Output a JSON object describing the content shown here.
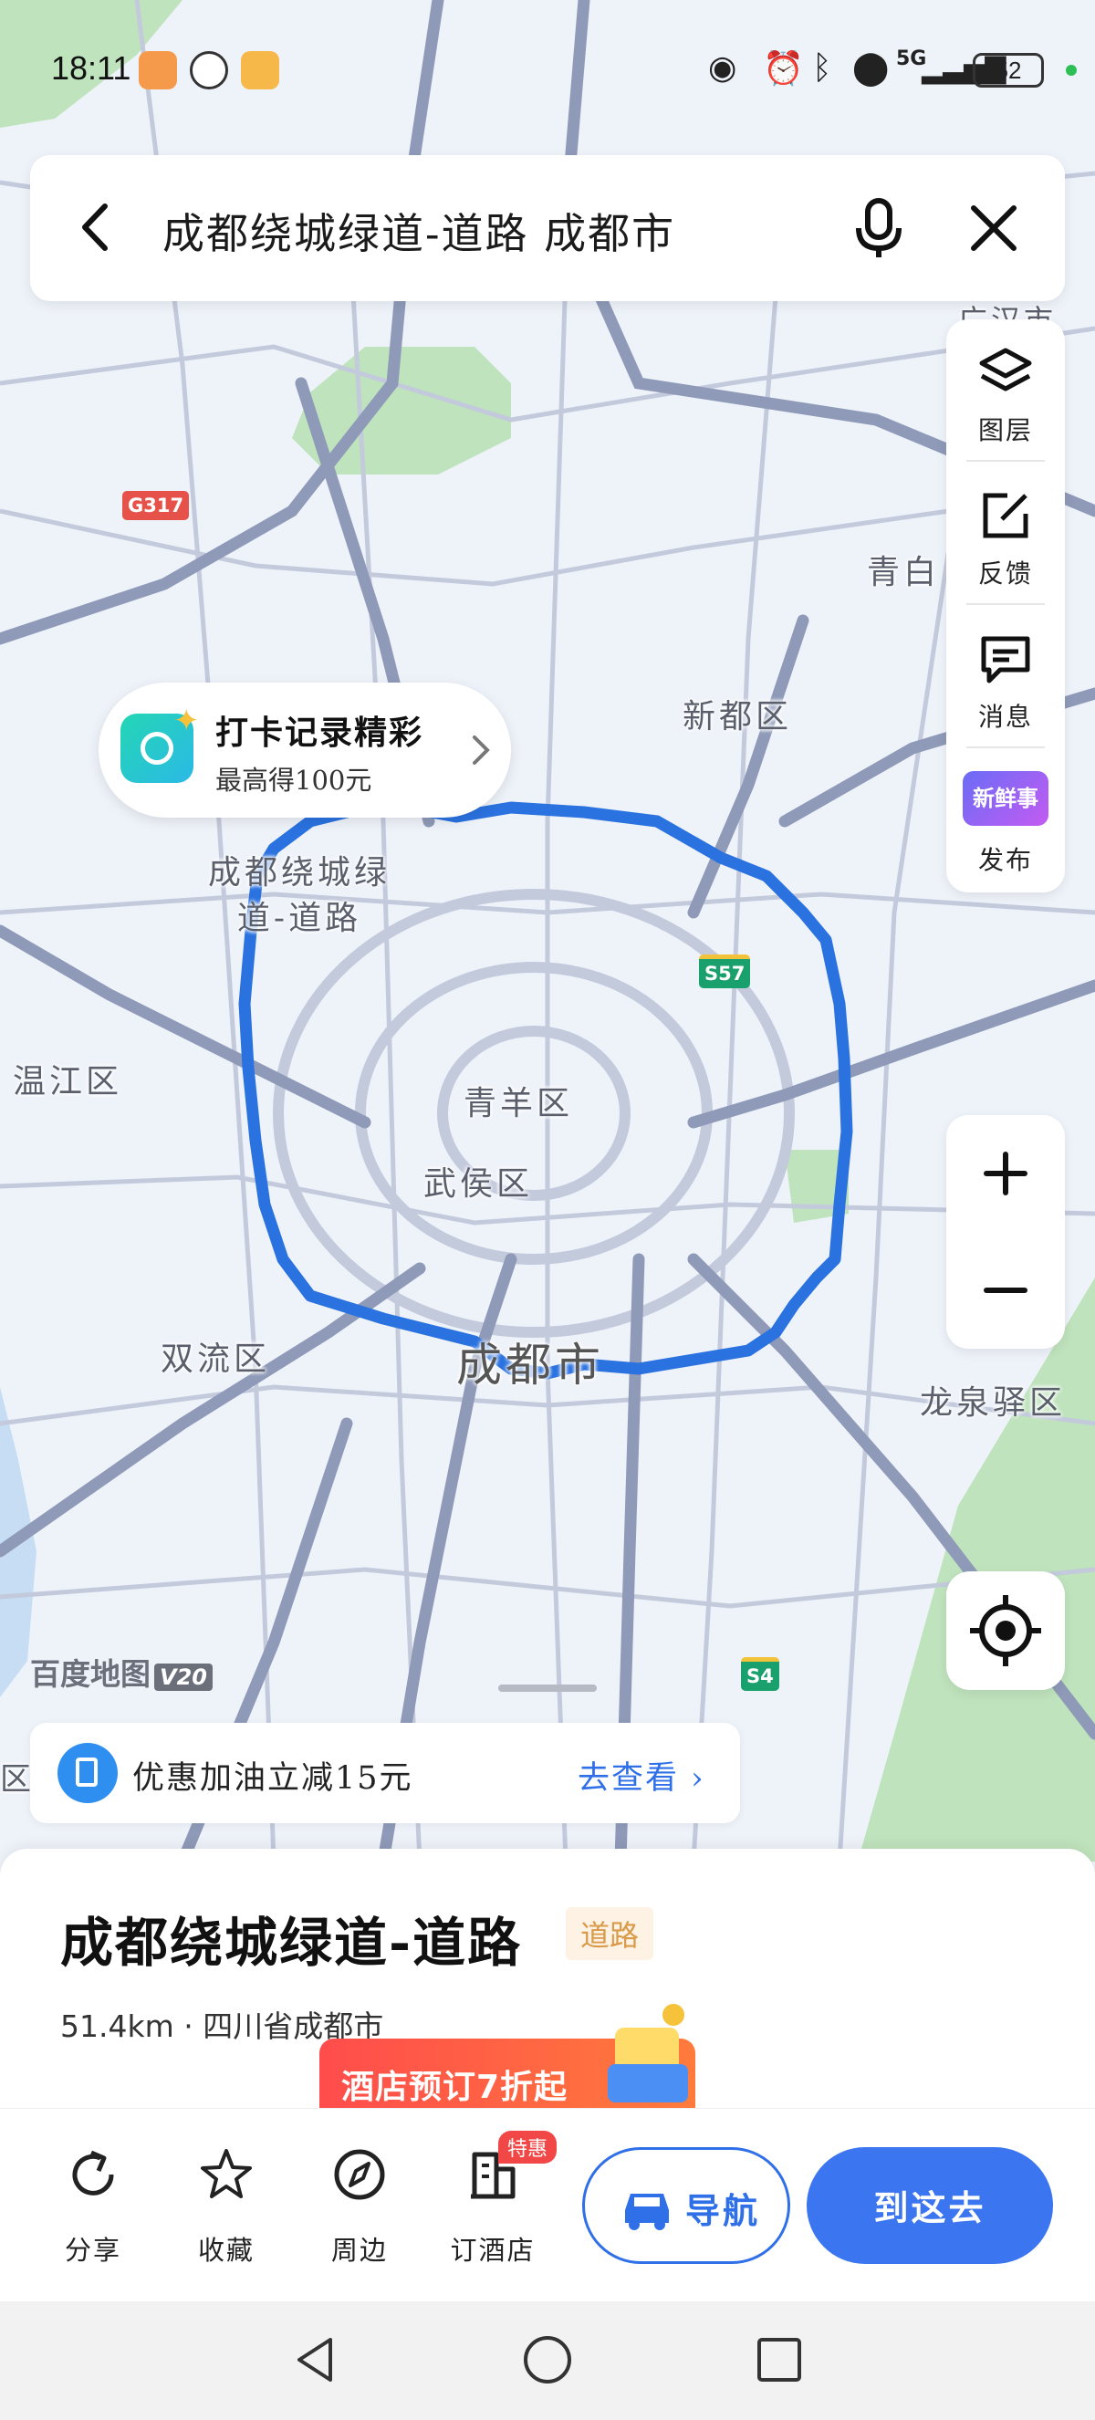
{
  "status_bar": {
    "time": "18:11",
    "network": "5G",
    "battery": "52"
  },
  "search": {
    "query": "成都绕城绿道-道路  成都市"
  },
  "map_tools": [
    {
      "label": "图层",
      "icon": "layers-icon"
    },
    {
      "label": "反馈",
      "icon": "feedback-icon"
    },
    {
      "label": "消息",
      "icon": "message-icon"
    },
    {
      "label": "发布",
      "icon": "new-thing-icon",
      "badge": "新鲜事"
    }
  ],
  "checkin": {
    "title": "打卡记录精彩",
    "subtitle": "最高得100元"
  },
  "map": {
    "labels": {
      "route": "成都绕城绿\n道-道路",
      "xindu": "新都区",
      "qingbai": "青白",
      "guanghan": "广汉市",
      "wenjiang": "温江区",
      "qingyang": "青羊区",
      "wuhou": "武侯区",
      "shuangliu": "双流区",
      "chengdu": "成都市",
      "longquanyi": "龙泉驿区",
      "qu_edge": "区"
    },
    "shields": {
      "g317": "G317",
      "s57": "S57",
      "s4": "S4"
    },
    "logo": "百度地图",
    "logo_version": "V20",
    "colors": {
      "route": "#2a72e0",
      "road_major": "#8e9ab8",
      "road_minor": "#c3cadc",
      "green": "#bfe3bd",
      "water": "#9fc7f0"
    }
  },
  "fuel_banner": {
    "text": "优惠加油立减15元",
    "link": "去查看"
  },
  "place": {
    "title": "成都绕城绿道-道路",
    "tag": "道路",
    "info": "51.4km · 四川省成都市"
  },
  "promo": {
    "text": "酒店预订7折起"
  },
  "actions": [
    {
      "label": "分享",
      "icon": "share-icon"
    },
    {
      "label": "收藏",
      "icon": "star-icon"
    },
    {
      "label": "周边",
      "icon": "compass-icon"
    },
    {
      "label": "订酒店",
      "icon": "hotel-icon"
    }
  ],
  "hotel_badge": "特惠",
  "nav_button": "导航",
  "go_button": "到这去"
}
